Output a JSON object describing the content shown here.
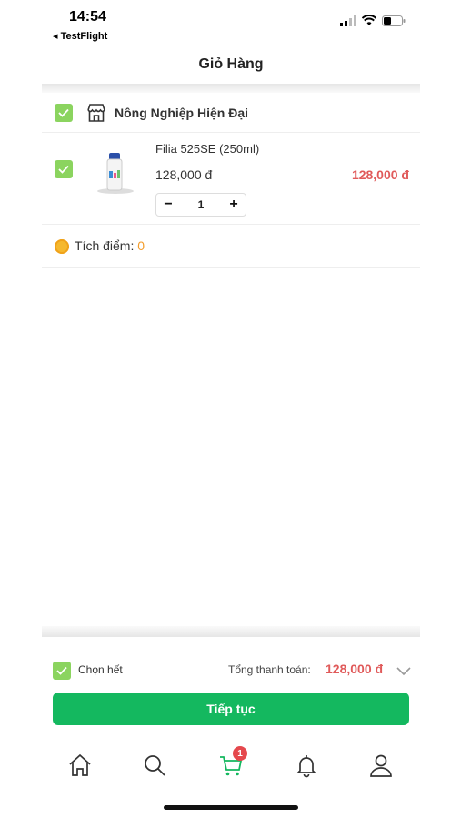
{
  "status_bar": {
    "time": "14:54",
    "back_app": "◂ TestFlight"
  },
  "nav": {
    "title": "Giỏ Hàng"
  },
  "shop": {
    "name": "Nông Nghiệp Hiện Đại",
    "checked": true
  },
  "cart_items": [
    {
      "name": "Filia 525SE (250ml)",
      "unit_price": "128,000 đ",
      "line_total": "128,000 đ",
      "quantity": "1",
      "checked": true,
      "decrement": "−",
      "increment": "+"
    }
  ],
  "points": {
    "label": "Tích điểm: ",
    "value": "0"
  },
  "footer": {
    "select_all_label": "Chọn hết",
    "total_label": "Tổng thanh toán:",
    "total_value": "128,000 đ",
    "cta_label": "Tiếp tục"
  },
  "tabbar": {
    "cart_badge": "1"
  },
  "colors": {
    "accent": "#14b85f",
    "checkbox": "#8bd45f",
    "price": "#e05a5a",
    "points": "#f39c2a"
  }
}
